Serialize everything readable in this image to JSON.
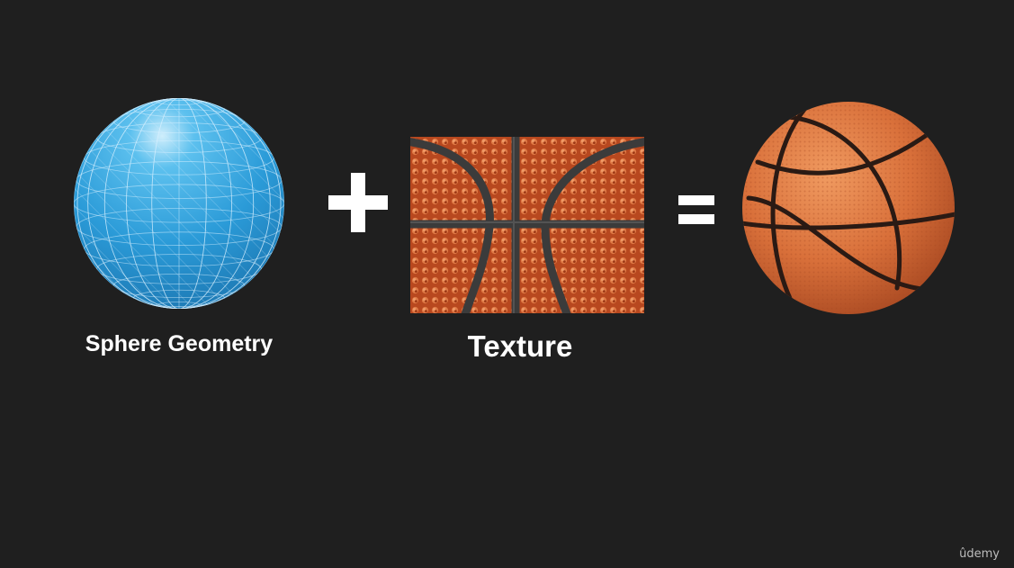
{
  "diagram": {
    "left": {
      "label": "Sphere Geometry",
      "icon": "wireframe-sphere-icon",
      "color": "#2fa8e0"
    },
    "operator_plus": "+",
    "middle": {
      "label": "Texture",
      "icon": "basketball-texture-icon",
      "color": "#c5532a"
    },
    "operator_equals": "=",
    "right": {
      "icon": "basketball-icon",
      "color": "#d9703a"
    }
  },
  "watermark": "ûdemy"
}
